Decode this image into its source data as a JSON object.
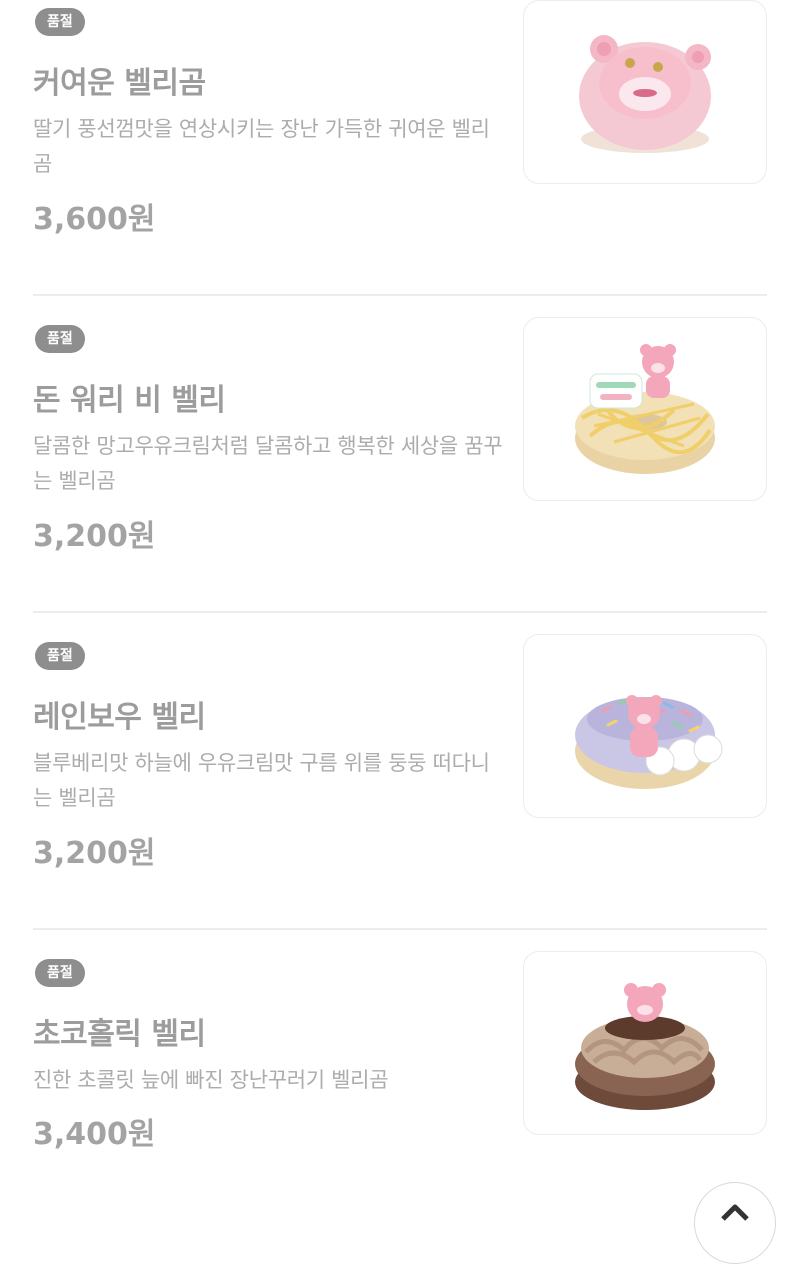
{
  "products": [
    {
      "badge": "품절",
      "name": "커여운 벨리곰",
      "description": "딸기 풍선껌맛을 연상시키는 장난 가득한 귀여운 벨리곰",
      "price": "3,600원",
      "image_icon": "pink-bear-face-donut-icon"
    },
    {
      "badge": "품절",
      "name": "돈 워리 비 벨리",
      "description": "달콤한 망고우유크림처럼 달콤하고 행복한 세상을 꿈꾸는 벨리곰",
      "price": "3,200원",
      "image_icon": "mango-drizzle-donut-icon"
    },
    {
      "badge": "품절",
      "name": "레인보우 벨리",
      "description": "블루베리맛 하늘에 우유크림맛 구름 위를 둥둥 떠다니는 벨리곰",
      "price": "3,200원",
      "image_icon": "rainbow-sprinkle-donut-icon"
    },
    {
      "badge": "품절",
      "name": "초코홀릭 벨리",
      "description": "진한 초콜릿 늪에 빠진 장난꾸러기 벨리곰",
      "price": "3,400원",
      "image_icon": "chocolate-cream-donut-icon"
    }
  ],
  "scroll_top_icon": "chevron-up-icon",
  "colors": {
    "badge_bg": "#8e8e8e",
    "text_muted": "#9c9c9c",
    "divider": "#ececec"
  }
}
